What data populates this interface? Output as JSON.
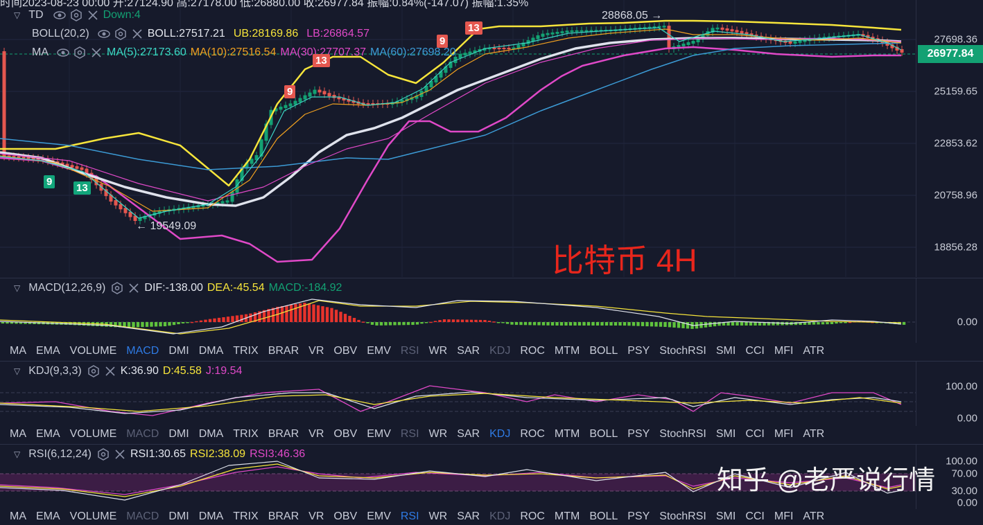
{
  "header_cut_text": "时间2023-08-23 00:00  开:27124.90  高:27178.00  低:26880.00  收:26977.84  振幅:0.84%(-147.07)  振幅:1.35%",
  "main": {
    "td": {
      "name": "TD",
      "value": "Down:4"
    },
    "boll": {
      "name": "BOLL(20,2)",
      "boll": "BOLL:27517.21",
      "ub": "UB:28169.86",
      "lb": "LB:26864.57"
    },
    "ma": {
      "name": "MA",
      "ma5": "MA(5):27173.60",
      "ma10": "MA(10):27516.54",
      "ma30": "MA(30):27707.37",
      "ma60": "MA(60):27698.20"
    },
    "price_axis": [
      "27698.36",
      "25159.65",
      "22853.62",
      "20758.96",
      "18856.28"
    ],
    "current_price": "26977.84",
    "high_annotation": "28868.05 →",
    "low_annotation": "← 19549.09",
    "title_overlay": "比特币 4H",
    "td_badges": [
      {
        "text": "9",
        "color": "green"
      },
      {
        "text": "13",
        "color": "green"
      },
      {
        "text": "9",
        "color": "red"
      },
      {
        "text": "13",
        "color": "red"
      },
      {
        "text": "9",
        "color": "red"
      },
      {
        "text": "13",
        "color": "red"
      }
    ]
  },
  "macd": {
    "name": "MACD(12,26,9)",
    "dif": "DIF:-138.00",
    "dea": "DEA:-45.54",
    "macd": "MACD:-184.92",
    "axis": [
      "0.00"
    ]
  },
  "kdj": {
    "name": "KDJ(9,3,3)",
    "k": "K:36.90",
    "d": "D:45.58",
    "j": "J:19.54",
    "axis": [
      "100.00",
      "0.00"
    ]
  },
  "rsi": {
    "name": "RSI(6,12,24)",
    "rsi1": "RSI1:30.65",
    "rsi2": "RSI2:38.09",
    "rsi3": "RSI3:46.36",
    "axis": [
      "100.00",
      "70.00",
      "30.00",
      "0.00"
    ]
  },
  "indicator_tabs": [
    "MA",
    "EMA",
    "VOLUME",
    "MACD",
    "DMI",
    "DMA",
    "TRIX",
    "BRAR",
    "VR",
    "OBV",
    "EMV",
    "RSI",
    "WR",
    "SAR",
    "KDJ",
    "ROC",
    "MTM",
    "BOLL",
    "PSY",
    "StochRSI",
    "SMI",
    "CCI",
    "MFI",
    "ATR"
  ],
  "tab_states_1": {
    "active": "MACD",
    "dim": [
      "RSI",
      "KDJ"
    ]
  },
  "tab_states_2": {
    "active": "KDJ",
    "dim": [
      "MACD",
      "RSI"
    ]
  },
  "tab_states_3": {
    "active": "RSI",
    "dim": [
      "MACD",
      "KDJ"
    ]
  },
  "watermark": "知乎 @老严说行情",
  "colors": {
    "bg": "#161a2b",
    "up": "#13a173",
    "down": "#e4574f",
    "yellow": "#f7e53b",
    "orange": "#f0a020",
    "cyan": "#3dd6c5",
    "magenta": "#e049c8",
    "white": "#dfe2ec",
    "blue": "#3c9bd6"
  }
}
